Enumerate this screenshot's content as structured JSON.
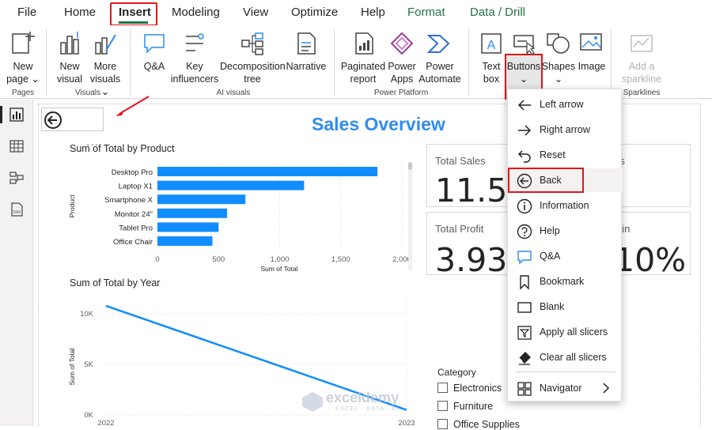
{
  "menu": {
    "file": "File",
    "home": "Home",
    "insert": "Insert",
    "modeling": "Modeling",
    "view": "View",
    "optimize": "Optimize",
    "help": "Help",
    "format": "Format",
    "data_drill": "Data / Drill"
  },
  "ribbon": {
    "new_page_1": "New",
    "new_page_2": "page",
    "new_visual_1": "New",
    "new_visual_2": "visual",
    "more_visuals_1": "More",
    "more_visuals_2": "visuals",
    "qa": "Q&A",
    "key_influencers_1": "Key",
    "key_influencers_2": "influencers",
    "decomposition_1": "Decomposition",
    "decomposition_2": "tree",
    "narrative": "Narrative",
    "paginated_1": "Paginated",
    "paginated_2": "report",
    "power_apps_1": "Power",
    "power_apps_2": "Apps",
    "power_automate_1": "Power",
    "power_automate_2": "Automate",
    "text_box_1": "Text",
    "text_box_2": "box",
    "buttons": "Buttons",
    "shapes": "Shapes",
    "image": "Image",
    "sparkline_1": "Add a",
    "sparkline_2": "sparkline",
    "groups": {
      "pages": "Pages",
      "visuals": "Visuals",
      "ai_visuals": "AI visuals",
      "power_platform": "Power Platform",
      "sparklines": "Sparklines"
    }
  },
  "canvas": {
    "title": "Sales Overview",
    "bar_chart_title": "Sum of Total by Product",
    "line_chart_title": "Sum of Total by Year",
    "card1_label": "Total Sales",
    "card1_value": "11.53",
    "card2_label": "rs",
    "card3_label": "Total Profit",
    "card3_value": "3.93K",
    "card4_label": "gin",
    "card4_value": "10%",
    "slicer_title": "Category",
    "slicer_items": [
      "Electronics",
      "Furniture",
      "Office Supplies"
    ]
  },
  "chart_data": [
    {
      "type": "bar",
      "title": "Sum of Total by Product",
      "ylabel": "Product",
      "xlabel": "Sum of Total",
      "categories": [
        "Desktop Pro",
        "Laptop X1",
        "Smartphone X",
        "Monitor 24\"",
        "Tablet Pro",
        "Office Chair"
      ],
      "values": [
        1800,
        1200,
        720,
        570,
        500,
        450
      ],
      "xlim": [
        0,
        2000
      ],
      "xticks": [
        "0",
        "500",
        "1,000",
        "1,500",
        "2,000"
      ]
    },
    {
      "type": "line",
      "title": "Sum of Total by Year",
      "ylabel": "Sum of Total",
      "x": [
        "2022",
        "2023"
      ],
      "values": [
        10800,
        500
      ],
      "ylim": [
        0,
        11500
      ],
      "yticks": [
        "0K",
        "5K",
        "10K"
      ]
    }
  ],
  "dropdown": {
    "items": [
      {
        "label": "Left arrow",
        "icon": "left-arrow-icon"
      },
      {
        "label": "Right arrow",
        "icon": "right-arrow-icon"
      },
      {
        "label": "Reset",
        "icon": "reset-icon"
      },
      {
        "label": "Back",
        "icon": "back-icon"
      },
      {
        "label": "Information",
        "icon": "information-icon"
      },
      {
        "label": "Help",
        "icon": "help-icon"
      },
      {
        "label": "Q&A",
        "icon": "qa-icon"
      },
      {
        "label": "Bookmark",
        "icon": "bookmark-icon"
      },
      {
        "label": "Blank",
        "icon": "blank-icon"
      },
      {
        "label": "Apply all slicers",
        "icon": "apply-slicers-icon"
      },
      {
        "label": "Clear all slicers",
        "icon": "clear-slicers-icon"
      },
      {
        "label": "Navigator",
        "icon": "navigator-icon"
      }
    ]
  },
  "watermark": {
    "name": "exceldemy",
    "tagline": "EXCEL · DATA · BI"
  },
  "colors": {
    "accent": "#217346",
    "highlight": "#e0161b",
    "bar": "#118dff",
    "title": "#2f8cf0"
  }
}
